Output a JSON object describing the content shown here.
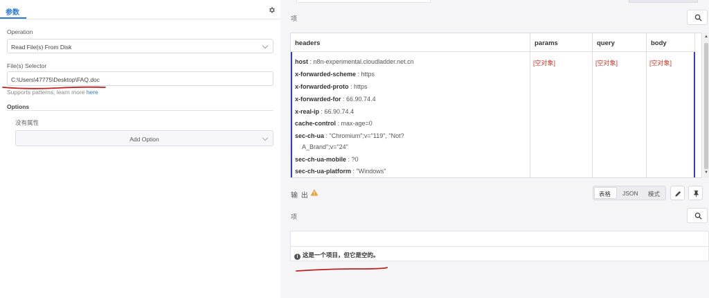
{
  "left": {
    "tab_label": "参数",
    "operation_label": "Operation",
    "operation_value": "Read File(s) From Disk",
    "file_selector_label": "File(s) Selector",
    "file_selector_value": "C:\\Users\\47775\\Desktop\\FAQ.doc",
    "hint_text": "Supports patterns, learn more ",
    "hint_link": "here",
    "options_title": "Options",
    "no_property": "没有属性",
    "add_option": "Add Option"
  },
  "input": {
    "item_label": "项",
    "columns": [
      "headers",
      "params",
      "query",
      "body"
    ],
    "headers": [
      {
        "key": "host",
        "value": "n8n-experimental.cloudladder.net.cn"
      },
      {
        "key": "x-forwarded-scheme",
        "value": "https"
      },
      {
        "key": "x-forwarded-proto",
        "value": "https"
      },
      {
        "key": "x-forwarded-for",
        "value": "66.90.74.4"
      },
      {
        "key": "x-real-ip",
        "value": "66.90.74.4"
      },
      {
        "key": "cache-control",
        "value": "max-age=0"
      },
      {
        "key": "sec-ch-ua",
        "value": "\"Chromium\";v=\"119\", \"Not?",
        "value_cont": "A_Brand\";v=\"24\""
      },
      {
        "key": "sec-ch-ua-mobile",
        "value": "?0"
      },
      {
        "key": "sec-ch-ua-platform",
        "value": "\"Windows\""
      }
    ],
    "empty_object": "[空对象]"
  },
  "output": {
    "title": "输 出",
    "view_modes": [
      "表格",
      "JSON",
      "模式"
    ],
    "active_mode": "表格",
    "item_label": "项",
    "empty_message": "这是一个项目，但它是空的。"
  },
  "colors": {
    "accent": "#2d7bd1",
    "empty_object": "#c0392b",
    "annotation_red": "#c0201f",
    "selection_blue": "#3a3ac8"
  }
}
